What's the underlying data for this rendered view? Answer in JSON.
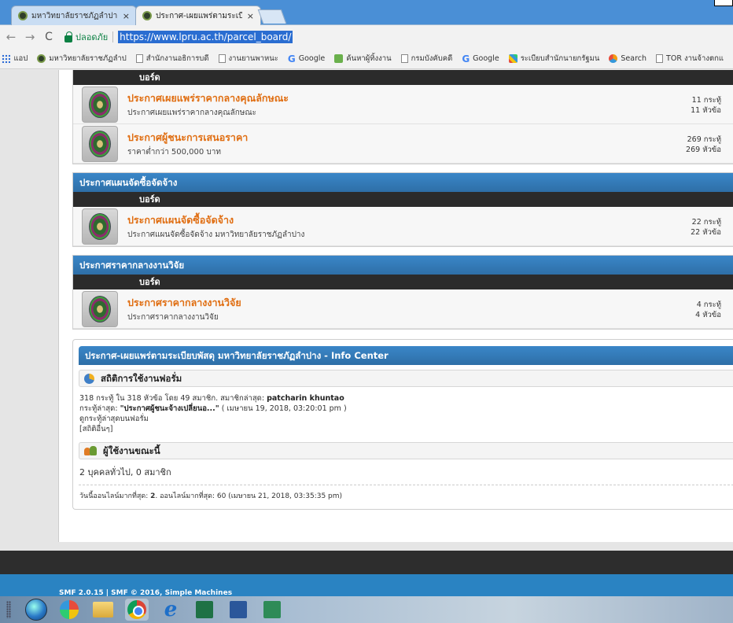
{
  "browser": {
    "tabs": [
      {
        "title": "มหาวิทยาลัยราชภัฏลำปาง La",
        "close": "×"
      },
      {
        "title": "ประกาศ-เผยแพร่ตามระเบียบ",
        "close": "×"
      }
    ],
    "nav": {
      "back": "←",
      "forward": "→",
      "reload": "C"
    },
    "secure_label": "ปลอดภัย",
    "url": "https://www.lpru.ac.th/parcel_board/",
    "bookmarks": [
      {
        "label": "แอป",
        "icon": "apps-icon"
      },
      {
        "label": "มหาวิทยาลัยราชภัฏลำป",
        "icon": "seal-icon"
      },
      {
        "label": "สำนักงานอธิการบดี",
        "icon": "page-icon"
      },
      {
        "label": "งานยานพาหนะ",
        "icon": "page-icon"
      },
      {
        "label": "Google",
        "icon": "google-icon"
      },
      {
        "label": "ค้นหาผู้ทิ้งงาน",
        "icon": "green-icon"
      },
      {
        "label": "กรมบังคับคดี",
        "icon": "page-icon"
      },
      {
        "label": "Google",
        "icon": "google-icon"
      },
      {
        "label": "ระเบียบสำนักนายกรัฐมน",
        "icon": "multi-icon"
      },
      {
        "label": "Search",
        "icon": "search-brand-icon"
      },
      {
        "label": "TOR งานจ้างตกแ",
        "icon": "page-icon"
      }
    ]
  },
  "forum": {
    "section1": {
      "board_header": "บอร์ด",
      "boards": [
        {
          "title": "ประกาศเผยแพร่ราคากลางคุณลักษณะ",
          "desc": "ประกาศเผยแพร่ราคากลางคุณลักษณะ",
          "posts": "11 กระทู้",
          "topics": "11 หัวข้อ"
        },
        {
          "title": "ประกาศผู้ชนะการเสนอราคา",
          "desc": "ราคาต่ำกว่า 500,000 บาท",
          "posts": "269 กระทู้",
          "topics": "269 หัวข้อ"
        }
      ]
    },
    "section2": {
      "category": "ประกาศแผนจัดซื้อจัดจ้าง",
      "board_header": "บอร์ด",
      "boards": [
        {
          "title": "ประกาศแผนจัดซื้อจัดจ้าง",
          "desc": "ประกาศแผนจัดซื้อจัดจ้าง มหาวิทยาลัยราชภัฏลำปาง",
          "posts": "22 กระทู้",
          "topics": "22 หัวข้อ"
        }
      ]
    },
    "section3": {
      "category": "ประกาศราคากลางงานวิจัย",
      "board_header": "บอร์ด",
      "boards": [
        {
          "title": "ประกาศราคากลางงานวิจัย",
          "desc": "ประกาศราคากลางงานวิจัย",
          "posts": "4 กระทู้",
          "topics": "4 หัวข้อ"
        }
      ]
    },
    "info_center": {
      "title": "ประกาศ-เผยแพร่ตามระเบียบพัสดุ มหาวิทยาลัยราชภัฏลำปาง - Info Center",
      "stats_title": "สถิติการใช้งานฟอรั่ม",
      "stats_line1_prefix": "318 กระทู้ ใน 318 หัวข้อ โดย 49 สมาชิก. สมาชิกล่าสุด: ",
      "latest_member": "patcharin khuntao",
      "stats_line2_prefix": "กระทู้ล่าสุด: ",
      "latest_post": "\"ประกาศผู้ชนะจ้างเปลี่ยนอ...\"",
      "latest_post_time": " ( เมษายน 19, 2018, 03:20:01 pm )",
      "recent_posts_link": "ดูกระทู้ล่าสุดบนฟอรั่ม",
      "more_stats_link": "[สถิติอื่นๆ]",
      "online_title": "ผู้ใช้งานขณะนี้",
      "online_text": "2 บุคคลทั่วไป, 0 สมาชิก",
      "record_prefix": "วันนี้ออนไลน์มากที่สุด: ",
      "record_today": "2",
      "record_mid": ". ออนไลน์มากที่สุด: 60 (เมษายน 21, 2018, 03:35:35 pm)"
    }
  },
  "footer": {
    "text": "SMF 2.0.15 | SMF © 2016, Simple Machines"
  }
}
